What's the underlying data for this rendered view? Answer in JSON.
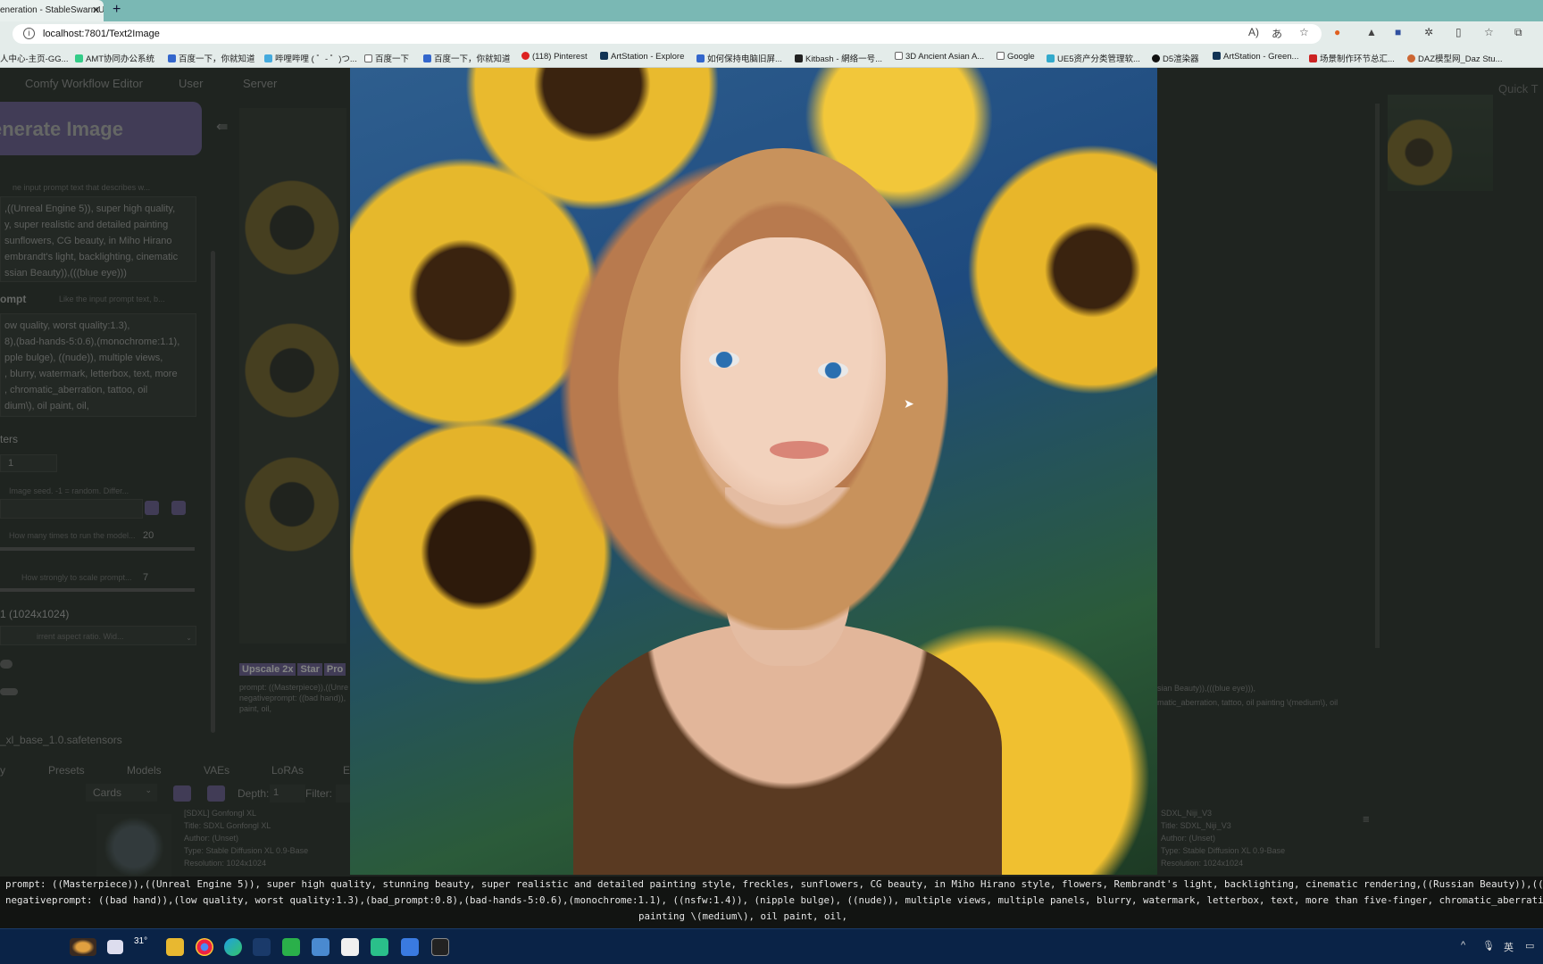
{
  "browser": {
    "tab_title": "eneration - StableSwarmUI",
    "tab_close": "✕",
    "new_tab": "+",
    "url": "localhost:7801/Text2Image",
    "bookmarks": [
      "人中心-主页-GG...",
      "AMT协同办公系统",
      "百度一下，你就知道",
      "哔哩哔哩 ( ゜- ゜)つ...",
      "百度一下",
      "百度一下，你就知道",
      "(118) Pinterest",
      "ArtStation - Explore",
      "如何保持电脑旧屏...",
      "Kitbash - 網络一号...",
      "3D Ancient Asian A...",
      "Google",
      "UE5资产分类管理软...",
      "D5渲染器",
      "ArtStation - Green...",
      "场景制作环节总汇...",
      "DAZ模型网_Daz Stu..."
    ]
  },
  "app": {
    "nav": [
      "Comfy Workflow Editor",
      "User",
      "Server"
    ],
    "generate_button": "enerate Image",
    "quick_tools": "Quick T",
    "left": {
      "prompt_placeholder": "ne input prompt text that describes w...",
      "prompt_lines": [
        ",((Unreal Engine 5)), super high quality,",
        "y, super realistic and detailed painting",
        "sunflowers, CG beauty, in Miho Hirano",
        "embrandt's light, backlighting, cinematic",
        "ssian Beauty)),(((blue eye)))"
      ],
      "negative_label": "ompt",
      "negative_placeholder": "Like the input prompt text, b...",
      "negative_lines": [
        "ow quality, worst quality:1.3),",
        "8),(bad-hands-5:0.6),(monochrome:1.1),",
        "pple bulge), ((nude)), multiple views,",
        ", blurry, watermark, letterbox, text, more",
        ", chromatic_aberration, tattoo, oil",
        "dium\\), oil paint, oil,"
      ],
      "params_label": "ters",
      "images_value": "1",
      "seed_hint": "Image seed. -1 = random. Differ...",
      "steps_hint": "How many times to run the model...",
      "steps_value": "20",
      "cfg_hint": "How strongly to scale prompt...",
      "cfg_value": "7",
      "resolution_label": "1 (1024x1024)",
      "resolution_hint": "irrent aspect ratio. Wid..."
    },
    "upscale_buttons": [
      "Upscale 2x",
      "Star",
      "Pro"
    ],
    "center_caption_lines": [
      "prompt: ((Masterpiece)),((Unre",
      "negativeprompt: ((bad hand)),",
      "paint, oil,"
    ],
    "right_caption_lines": [
      "sian Beauty)),(((blue eye))),",
      "matic_aberration, tattoo, oil painting \\(medium\\), oil"
    ],
    "model_file": "_xl_base_1.0.safetensors",
    "bottom_tabs": [
      "y",
      "Presets",
      "Models",
      "VAEs",
      "LoRAs",
      "E"
    ],
    "view_mode": "Cards",
    "depth_label": "Depth:",
    "depth_value": "1",
    "filter_label": "Filter:",
    "model_cards": [
      {
        "name": "[SDXL] Gonfongl XL",
        "title": "Title: SDXL Gonfongl XL",
        "author": "Author: (Unset)",
        "type": "Type: Stable Diffusion XL 0.9-Base",
        "resolution": "Resolution: 1024x1024"
      },
      {
        "name": "SDXL_Niji_V3",
        "title": "Title: SDXL_Niji_V3",
        "author": "Author: (Unset)",
        "type": "Type: Stable Diffusion XL 0.9-Base",
        "resolution": "Resolution: 1024x1024"
      }
    ]
  },
  "overlay": {
    "line1": "prompt: ((Masterpiece)),((Unreal Engine 5)), super high quality, stunning beauty, super realistic and detailed painting style, freckles, sunflowers, CG beauty, in Miho Hirano style, flowers, Rembrandt's light, backlighting, cinematic rendering,((Russian Beauty)),(((blue eye))),",
    "line2": "negativeprompt: ((bad hand)),(low quality, worst quality:1.3),(bad_prompt:0.8),(bad-hands-5:0.6),(monochrome:1.1), ((nsfw:1.4)), (nipple bulge), ((nude)), multiple views, multiple panels, blurry, watermark, letterbox, text, more than five-finger, chromatic_aberration, tattoo, oil",
    "line3": "painting \\(medium\\), oil paint, oil,"
  },
  "taskbar": {
    "weather": "31°",
    "tray_lang": "英"
  },
  "colors": {
    "accent_purple": "#6b5d9a",
    "browser_tabbar": "#7ab8b4",
    "taskbar": "#0a2347"
  }
}
